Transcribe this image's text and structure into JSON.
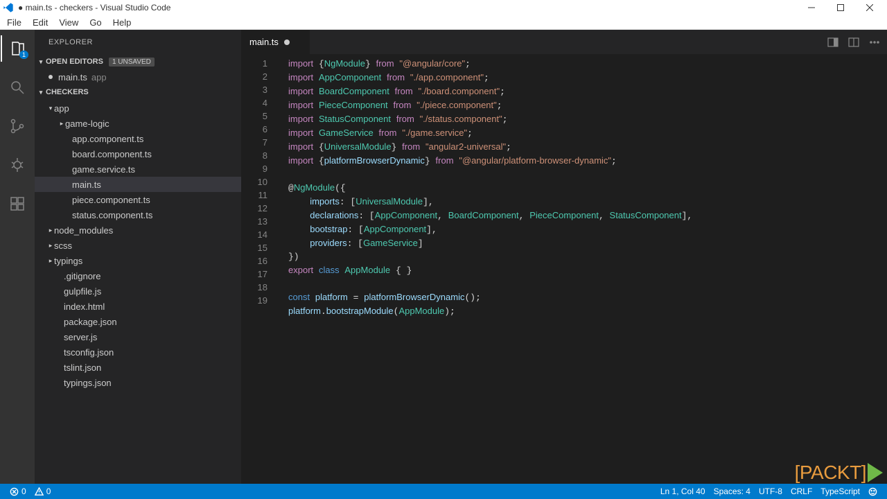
{
  "title": "● main.ts - checkers - Visual Studio Code",
  "menu": [
    "File",
    "Edit",
    "View",
    "Go",
    "Help"
  ],
  "activity_badge": "1",
  "sidebar": {
    "title": "EXPLORER",
    "open_editors": {
      "label": "OPEN EDITORS",
      "badge": "1 UNSAVED"
    },
    "open_file": {
      "name": "main.ts",
      "dir": "app"
    },
    "project": "CHECKERS",
    "tree": [
      {
        "label": "app",
        "indent": 18,
        "expanded": true,
        "folder": true
      },
      {
        "label": "game-logic",
        "indent": 34,
        "expanded": false,
        "folder": true
      },
      {
        "label": "app.component.ts",
        "indent": 44,
        "folder": false
      },
      {
        "label": "board.component.ts",
        "indent": 44,
        "folder": false
      },
      {
        "label": "game.service.ts",
        "indent": 44,
        "folder": false
      },
      {
        "label": "main.ts",
        "indent": 44,
        "folder": false,
        "selected": true
      },
      {
        "label": "piece.component.ts",
        "indent": 44,
        "folder": false
      },
      {
        "label": "status.component.ts",
        "indent": 44,
        "folder": false
      },
      {
        "label": "node_modules",
        "indent": 18,
        "expanded": false,
        "folder": true
      },
      {
        "label": "scss",
        "indent": 18,
        "expanded": false,
        "folder": true
      },
      {
        "label": "typings",
        "indent": 18,
        "expanded": false,
        "folder": true
      },
      {
        "label": ".gitignore",
        "indent": 32,
        "folder": false
      },
      {
        "label": "gulpfile.js",
        "indent": 32,
        "folder": false
      },
      {
        "label": "index.html",
        "indent": 32,
        "folder": false
      },
      {
        "label": "package.json",
        "indent": 32,
        "folder": false
      },
      {
        "label": "server.js",
        "indent": 32,
        "folder": false
      },
      {
        "label": "tsconfig.json",
        "indent": 32,
        "folder": false
      },
      {
        "label": "tslint.json",
        "indent": 32,
        "folder": false
      },
      {
        "label": "typings.json",
        "indent": 32,
        "folder": false
      }
    ]
  },
  "tab": {
    "name": "main.ts"
  },
  "code_lines": 19,
  "statusbar": {
    "errors": "0",
    "warnings": "0",
    "cursor": "Ln 1, Col 40",
    "spaces": "Spaces: 4",
    "encoding": "UTF-8",
    "eol": "CRLF",
    "language": "TypeScript"
  },
  "packt": "[PACKT]"
}
